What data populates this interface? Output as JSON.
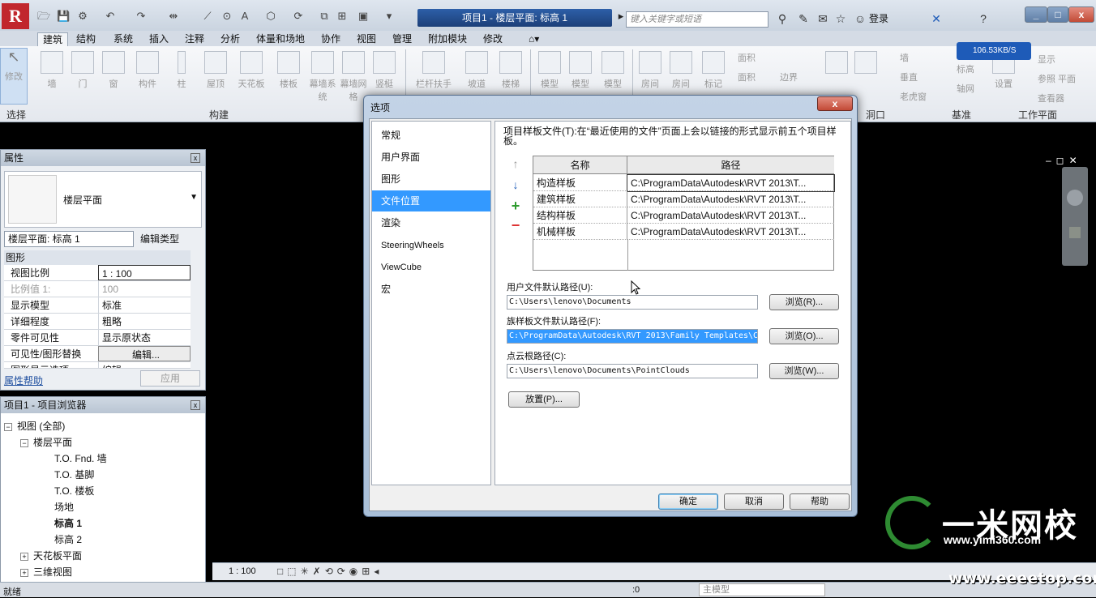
{
  "titlebar": {
    "logo": "R",
    "doc_title": "项目1 - 楼层平面: 标高 1",
    "search_placeholder": "键入关键字或短语",
    "login": "登录"
  },
  "ribbon": {
    "tabs": [
      "建筑",
      "结构",
      "系统",
      "插入",
      "注释",
      "分析",
      "体量和场地",
      "协作",
      "视图",
      "管理",
      "附加模块",
      "修改"
    ],
    "buttons": [
      "修改",
      "墙",
      "门",
      "窗",
      "构件",
      "柱",
      "屋顶",
      "天花板",
      "楼板",
      "幕墙系统",
      "幕墙网格",
      "竖梃",
      "栏杆扶手",
      "坡道",
      "楼梯",
      "模型",
      "模型",
      "模型",
      "房间",
      "房间",
      "标记"
    ],
    "small_buttons": [
      "面积",
      "面积",
      "边界",
      "标高",
      "轴网",
      "墙",
      "垂直",
      "老虎窗",
      "显示",
      "参照 平面",
      "查看器",
      "设置"
    ],
    "panels": [
      "选择",
      "构建",
      "洞口",
      "基准",
      "工作平面"
    ],
    "net_speed": "106.53KB/S"
  },
  "properties": {
    "title": "属性",
    "type_name": "楼层平面",
    "view_select": "楼层平面: 标高 1",
    "edit_type": "编辑类型",
    "group": "图形",
    "rows": [
      {
        "k": "视图比例",
        "v": "1 : 100"
      },
      {
        "k": "比例值 1:",
        "v": "100"
      },
      {
        "k": "显示模型",
        "v": "标准"
      },
      {
        "k": "详细程度",
        "v": "粗略"
      },
      {
        "k": "零件可见性",
        "v": "显示原状态"
      },
      {
        "k": "可见性/图形替换",
        "v": "编辑..."
      },
      {
        "k": "图形显示选项",
        "v": "编辑..."
      }
    ],
    "help": "属性帮助",
    "apply": "应用"
  },
  "browser": {
    "title": "项目1 - 项目浏览器",
    "nodes": [
      "视图 (全部)",
      "楼层平面",
      "T.O. Fnd. 墙",
      "T.O. 基脚",
      "T.O. 楼板",
      "场地",
      "标高 1",
      "标高 2",
      "天花板平面",
      "三维视图"
    ]
  },
  "viewbar": {
    "scale": "1 : 100"
  },
  "statusbar": {
    "text": "就绪",
    "zero": ":0",
    "model": "主模型"
  },
  "watermark": {
    "title": "一米网校",
    "url": "www.yimi360.com",
    "site": "www.eeeetop.com"
  },
  "dialog": {
    "title": "选项",
    "close": "x",
    "nav": [
      "常规",
      "用户界面",
      "图形",
      "文件位置",
      "渲染",
      "SteeringWheels",
      "ViewCube",
      "宏"
    ],
    "selected_nav": 3,
    "template_desc": "项目样板文件(T):在“最近使用的文件”页面上会以链接的形式显示前五个项目样板。",
    "table": {
      "headers": [
        "名称",
        "路径"
      ],
      "rows": [
        {
          "name": "构造样板",
          "path": "C:\\ProgramData\\Autodesk\\RVT 2013\\T..."
        },
        {
          "name": "建筑样板",
          "path": "C:\\ProgramData\\Autodesk\\RVT 2013\\T..."
        },
        {
          "name": "结构样板",
          "path": "C:\\ProgramData\\Autodesk\\RVT 2013\\T..."
        },
        {
          "name": "机械样板",
          "path": "C:\\ProgramData\\Autodesk\\RVT 2013\\T..."
        }
      ]
    },
    "user_path_label": "用户文件默认路径(U):",
    "user_path": "C:\\Users\\lenovo\\Documents",
    "family_path_label": "族样板文件默认路径(F):",
    "family_path": "C:\\ProgramData\\Autodesk\\RVT 2013\\Family Templates\\C",
    "cloud_path_label": "点云根路径(C):",
    "cloud_path": "C:\\Users\\lenovo\\Documents\\PointClouds",
    "browse1": "浏览(R)...",
    "browse2": "浏览(O)...",
    "browse3": "浏览(W)...",
    "places": "放置(P)...",
    "ok": "确定",
    "cancel": "取消",
    "help": "帮助"
  }
}
